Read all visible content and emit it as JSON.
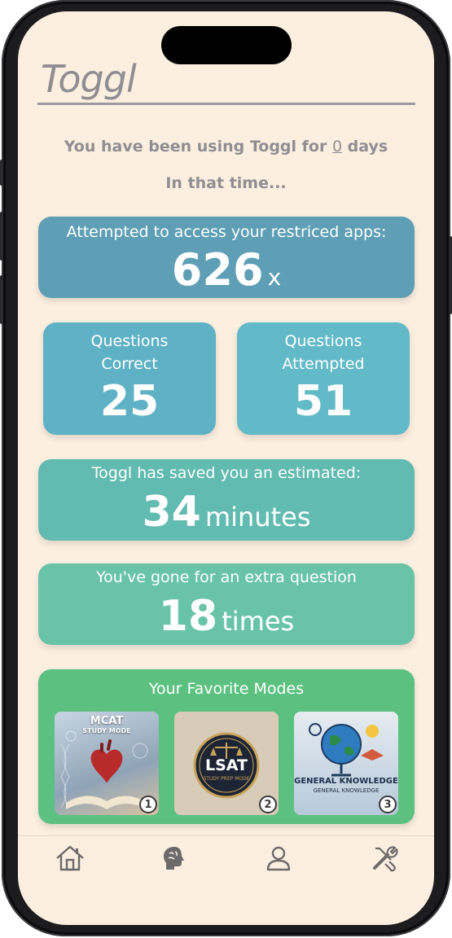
{
  "header": {
    "app_title": "Toggl"
  },
  "intro": {
    "prefix": "You have been using Toggl for ",
    "days": "0",
    "suffix": " days",
    "subtitle": "In that time..."
  },
  "stats": {
    "restricted": {
      "label": "Attempted to access your restriced apps:",
      "value": "626",
      "unit": "x"
    },
    "correct": {
      "label_line1": "Questions",
      "label_line2": "Correct",
      "value": "25"
    },
    "attempted": {
      "label_line1": "Questions",
      "label_line2": "Attempted",
      "value": "51"
    },
    "saved": {
      "label": "Toggl has saved you an estimated:",
      "value": "34",
      "unit": "minutes"
    },
    "extra": {
      "label": "You've gone for an extra question",
      "value": "18",
      "unit": "times"
    }
  },
  "favorites": {
    "title": "Your Favorite Modes",
    "modes": [
      {
        "art_line1": "MCAT",
        "art_line2": "STUDY MODE",
        "rank": "1"
      },
      {
        "art_line1": "LSAT",
        "art_line2": "STUDY PREP MODE",
        "rank": "2"
      },
      {
        "art_line1": "GENERAL KNOWLEDGE",
        "art_line2": "GENERAL KNOWLEDGE",
        "rank": "3"
      }
    ]
  },
  "tabbar": {
    "items": [
      {
        "icon": "home-icon"
      },
      {
        "icon": "brain-icon"
      },
      {
        "icon": "person-icon"
      },
      {
        "icon": "tools-icon"
      }
    ]
  },
  "colors": {
    "background": "#fcefe0",
    "card_blue": "#5e9fb5",
    "card_teal": "#62bbb1",
    "card_green": "#5cc180",
    "muted_text": "#8e8e93"
  }
}
